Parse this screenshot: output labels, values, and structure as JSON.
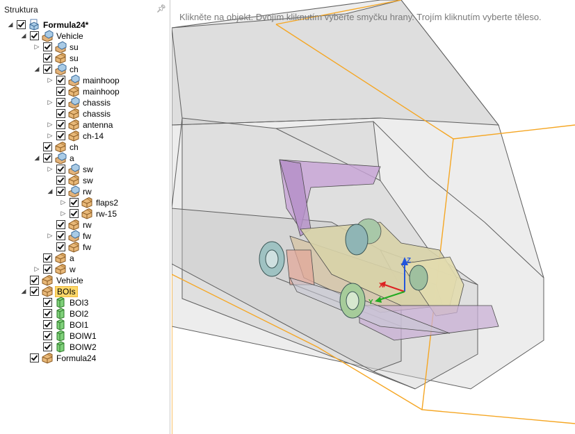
{
  "panel": {
    "title": "Struktura"
  },
  "viewport": {
    "hint": "Klikněte na objekt. Dvojím kliknutím vyberte smyčku hrany. Trojím kliknutím vyberte těleso."
  },
  "colors": {
    "bounding_box": "#f5a623",
    "selection": "#fcd86a"
  },
  "tree": [
    {
      "depth": 0,
      "expander": "expanded",
      "icon": "assembly-icon",
      "label": "Formula24*",
      "bold": true
    },
    {
      "depth": 1,
      "expander": "expanded",
      "icon": "component-icon",
      "label": "Vehicle"
    },
    {
      "depth": 2,
      "expander": "collapsed",
      "icon": "component-icon",
      "label": "su"
    },
    {
      "depth": 2,
      "expander": "none",
      "icon": "part-icon",
      "label": "su"
    },
    {
      "depth": 2,
      "expander": "expanded",
      "icon": "component-icon",
      "label": "ch"
    },
    {
      "depth": 3,
      "expander": "collapsed",
      "icon": "component-icon",
      "label": "mainhoop"
    },
    {
      "depth": 3,
      "expander": "none",
      "icon": "part-icon",
      "label": "mainhoop"
    },
    {
      "depth": 3,
      "expander": "collapsed",
      "icon": "component-icon",
      "label": "chassis"
    },
    {
      "depth": 3,
      "expander": "none",
      "icon": "part-icon",
      "label": "chassis"
    },
    {
      "depth": 3,
      "expander": "collapsed",
      "icon": "part-icon",
      "label": "antenna"
    },
    {
      "depth": 3,
      "expander": "collapsed",
      "icon": "part-icon",
      "label": "ch-14"
    },
    {
      "depth": 2,
      "expander": "none",
      "icon": "part-icon",
      "label": "ch"
    },
    {
      "depth": 2,
      "expander": "expanded",
      "icon": "component-icon",
      "label": "a"
    },
    {
      "depth": 3,
      "expander": "collapsed",
      "icon": "component-icon",
      "label": "sw"
    },
    {
      "depth": 3,
      "expander": "none",
      "icon": "part-icon",
      "label": "sw"
    },
    {
      "depth": 3,
      "expander": "expanded",
      "icon": "component-icon",
      "label": "rw"
    },
    {
      "depth": 4,
      "expander": "collapsed",
      "icon": "part-icon",
      "label": "flaps2"
    },
    {
      "depth": 4,
      "expander": "collapsed",
      "icon": "part-icon",
      "label": "rw-15"
    },
    {
      "depth": 3,
      "expander": "none",
      "icon": "part-icon",
      "label": "rw"
    },
    {
      "depth": 3,
      "expander": "collapsed",
      "icon": "component-icon",
      "label": "fw"
    },
    {
      "depth": 3,
      "expander": "none",
      "icon": "part-icon",
      "label": "fw"
    },
    {
      "depth": 2,
      "expander": "none",
      "icon": "part-icon",
      "label": "a"
    },
    {
      "depth": 2,
      "expander": "collapsed",
      "icon": "part-icon",
      "label": "w"
    },
    {
      "depth": 1,
      "expander": "none",
      "icon": "part-icon",
      "label": "Vehicle"
    },
    {
      "depth": 1,
      "expander": "expanded",
      "icon": "part-icon",
      "label": "BOIs",
      "selected": true
    },
    {
      "depth": 2,
      "expander": "none",
      "icon": "body-icon",
      "label": "BOI3"
    },
    {
      "depth": 2,
      "expander": "none",
      "icon": "body-icon",
      "label": "BOI2"
    },
    {
      "depth": 2,
      "expander": "none",
      "icon": "body-icon",
      "label": "BOI1"
    },
    {
      "depth": 2,
      "expander": "none",
      "icon": "body-icon",
      "label": "BOIW1"
    },
    {
      "depth": 2,
      "expander": "none",
      "icon": "body-icon",
      "label": "BOIW2"
    },
    {
      "depth": 1,
      "expander": "none",
      "icon": "part-icon",
      "label": "Formula24"
    }
  ],
  "axes": {
    "x": "X",
    "y": "Y",
    "z": "Z"
  }
}
